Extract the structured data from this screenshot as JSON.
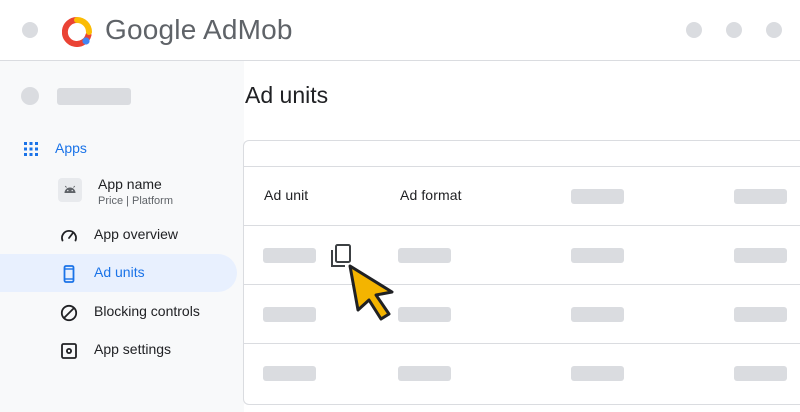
{
  "header": {
    "brand_google": "Google",
    "brand_product": "AdMob"
  },
  "sidebar": {
    "apps_label": "Apps",
    "app": {
      "name": "App name",
      "subtitle": "Price | Platform"
    },
    "items": [
      {
        "label": "App overview",
        "icon": "speedometer-icon"
      },
      {
        "label": "Ad units",
        "icon": "phone-icon",
        "active": true
      },
      {
        "label": "Blocking controls",
        "icon": "block-icon"
      },
      {
        "label": "App settings",
        "icon": "gear-icon"
      }
    ]
  },
  "main": {
    "title": "Ad units",
    "table": {
      "headers": [
        "Ad unit",
        "Ad format"
      ]
    }
  },
  "colors": {
    "accent": "#1a73e8",
    "active_bg": "#e8f0fe",
    "placeholder": "#dadce0",
    "cursor": "#f4b400"
  }
}
